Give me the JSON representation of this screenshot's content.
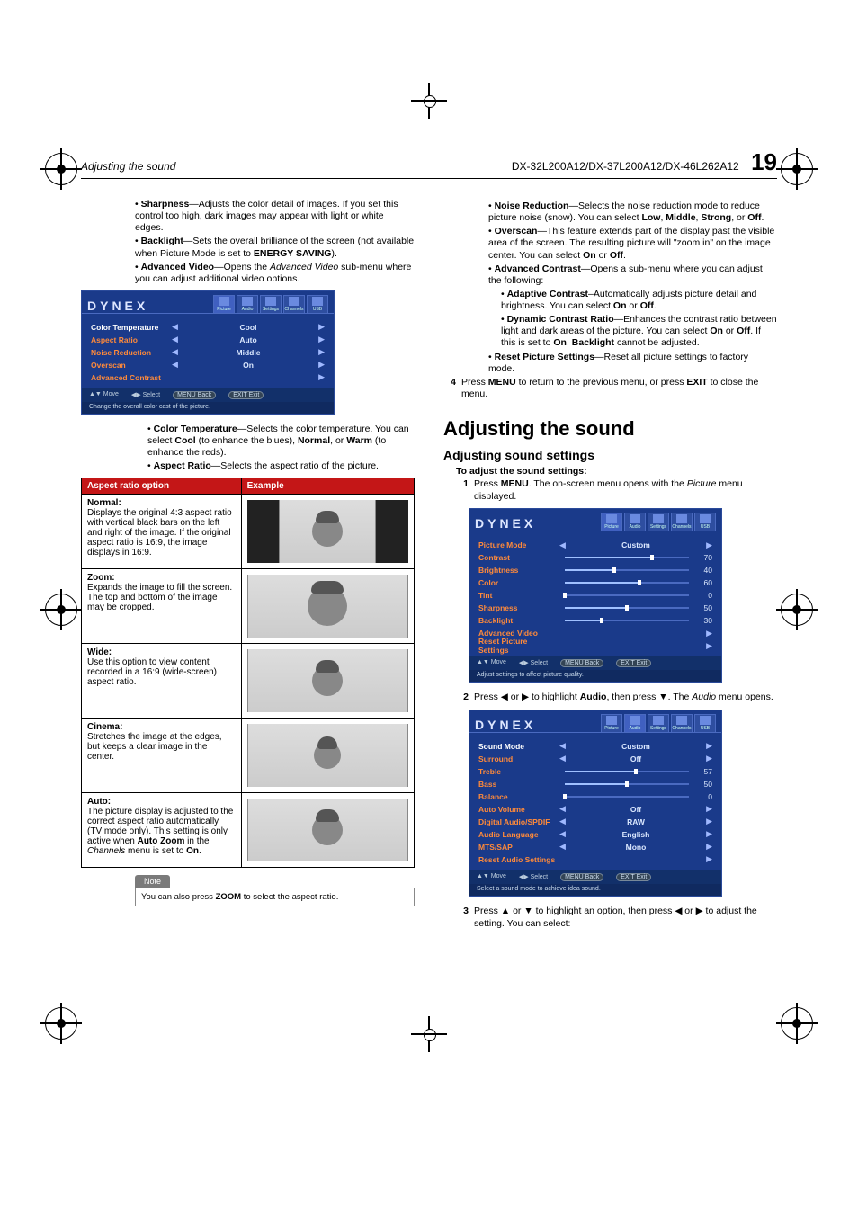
{
  "header": {
    "left": "Adjusting the sound",
    "models": "DX-32L200A12/DX-37L200A12/DX-46L262A12",
    "pageNum": "19"
  },
  "left": {
    "bullets1": [
      {
        "term": "Sharpness",
        "rest": "—Adjusts the color detail of images. If you set this control too high, dark images may appear with light or white edges."
      },
      {
        "term": "Backlight",
        "rest": "—Sets the overall brilliance of the screen (not available when Picture Mode is set to ",
        "term2": "ENERGY SAVING",
        "rest2": ")."
      },
      {
        "term": "Advanced Video",
        "rest": "—Opens the ",
        "ital": "Advanced Video",
        "rest2": " sub-menu where you can adjust additional video options."
      }
    ],
    "osd1": {
      "brand": "DYNEX",
      "tabs": [
        "Picture",
        "Audio",
        "Settings",
        "Channels",
        "USB"
      ],
      "activeTab": 0,
      "rows": [
        {
          "label": "Color Temperature",
          "labelColor": "white",
          "value": "Cool",
          "arrows": "both"
        },
        {
          "label": "Aspect Ratio",
          "value": "Auto",
          "arrows": "both"
        },
        {
          "label": "Noise Reduction",
          "value": "Middle",
          "arrows": "both"
        },
        {
          "label": "Overscan",
          "value": "On",
          "arrows": "both"
        },
        {
          "label": "Advanced Contrast",
          "value": "",
          "arrows": "right"
        }
      ],
      "hint": [
        "▲▼ Move",
        "◀▶ Select",
        "MENU Back",
        "EXIT Exit"
      ],
      "desc": "Change the overall color cast of the picture."
    },
    "bullets2": [
      {
        "html": "<b>Color Temperature</b>—Selects the color temperature. You can select <b>Cool</b> (to enhance the blues), <b>Normal</b>, or <b>Warm</b> (to enhance the reds)."
      },
      {
        "html": "<b>Aspect Ratio</b>—Selects the aspect ratio of the picture."
      }
    ],
    "aspect": {
      "h1": "Aspect ratio option",
      "h2": "Example",
      "rows": [
        {
          "title": "Normal:",
          "text": "Displays the original 4:3 aspect ratio with vertical black bars on the left and right of the image. If the original aspect ratio is 16:9, the image displays in 16:9.",
          "cls": "normal"
        },
        {
          "title": "Zoom:",
          "text": "Expands the image to fill the screen. The top and bottom of the image may be cropped.",
          "cls": "zoom"
        },
        {
          "title": "Wide:",
          "text": "Use this option to view content recorded in a 16:9 (wide-screen) aspect ratio.",
          "cls": "wide"
        },
        {
          "title": "Cinema:",
          "text": "Stretches the image at the edges, but keeps a clear image in the center.",
          "cls": "cinema"
        },
        {
          "title": "Auto:",
          "text": "The picture display is adjusted to the correct aspect ratio automatically (TV mode only). This setting is only active when <b>Auto Zoom</b> in the <i>Channels</i> menu is set to <b>On</b>.",
          "cls": "auto"
        }
      ]
    },
    "note": {
      "tab": "Note",
      "body": "You can also press <b>ZOOM</b> to select the aspect ratio."
    }
  },
  "right": {
    "bullets": [
      {
        "html": "<b>Noise Reduction</b>—Selects the noise reduction mode to reduce picture noise (snow). You can select <b>Low</b>, <b>Middle</b>, <b>Strong</b>, or <b>Off</b>."
      },
      {
        "html": "<b>Overscan</b>—This feature extends part of the display past the visible area of the screen. The resulting picture will \"zoom in\" on the image center. You can select <b>On</b> or <b>Off</b>."
      },
      {
        "html": "<b>Advanced Contrast</b>—Opens a sub-menu where you can adjust the following:",
        "sub": [
          {
            "html": "<b>Adaptive Contrast</b>–Automatically adjusts picture detail and brightness. You can select <b>On</b> or <b>Off</b>."
          },
          {
            "html": "<b>Dynamic Contrast Ratio</b>—Enhances the contrast ratio between light and dark areas of the picture. You can select <b>On</b> or <b>Off</b>. If this is set to <b>On</b>, <b>Backlight</b> cannot be adjusted."
          }
        ]
      },
      {
        "html": "<b>Reset Picture Settings</b>—Reset all picture settings to factory mode."
      }
    ],
    "step4": {
      "n": "4",
      "html": "Press <b>MENU</b> to return to the previous menu, or press <b>EXIT</b> to close the menu."
    },
    "h1": "Adjusting the sound",
    "h2": "Adjusting sound settings",
    "subhead": "To adjust the sound settings:",
    "step1": {
      "n": "1",
      "html": "Press <b>MENU</b>. The on-screen menu opens with the <i>Picture</i> menu displayed."
    },
    "osd2": {
      "brand": "DYNEX",
      "tabs": [
        "Picture",
        "Audio",
        "Settings",
        "Channels",
        "USB"
      ],
      "activeTab": 0,
      "rows": [
        {
          "label": "Picture Mode",
          "value": "Custom",
          "arrows": "both"
        },
        {
          "label": "Contrast",
          "slider": 70
        },
        {
          "label": "Brightness",
          "slider": 40
        },
        {
          "label": "Color",
          "slider": 60
        },
        {
          "label": "Tint",
          "slider": 0
        },
        {
          "label": "Sharpness",
          "slider": 50
        },
        {
          "label": "Backlight",
          "slider": 30
        },
        {
          "label": "Advanced Video",
          "value": "",
          "arrows": "right"
        },
        {
          "label": "Reset Picture Settings",
          "value": "",
          "arrows": "right"
        }
      ],
      "hint": [
        "▲▼ Move",
        "◀▶ Select",
        "MENU Back",
        "EXIT Exit"
      ],
      "desc": "Adjust settings to affect picture quality."
    },
    "step2": {
      "n": "2",
      "html": "Press ◀ or ▶ to highlight <b>Audio</b>, then press ▼. The <i>Audio</i> menu opens."
    },
    "osd3": {
      "brand": "DYNEX",
      "tabs": [
        "Picture",
        "Audio",
        "Settings",
        "Channels",
        "USB"
      ],
      "activeTab": 1,
      "rows": [
        {
          "label": "Sound Mode",
          "labelColor": "white",
          "value": "Custom",
          "arrows": "both"
        },
        {
          "label": "Surround",
          "value": "Off",
          "arrows": "both"
        },
        {
          "label": "Treble",
          "slider": 57
        },
        {
          "label": "Bass",
          "slider": 50
        },
        {
          "label": "Balance",
          "slider": 0
        },
        {
          "label": "Auto Volume",
          "value": "Off",
          "arrows": "both"
        },
        {
          "label": "Digital Audio/SPDIF",
          "value": "RAW",
          "arrows": "both"
        },
        {
          "label": "Audio Language",
          "value": "English",
          "arrows": "both"
        },
        {
          "label": "MTS/SAP",
          "value": "Mono",
          "arrows": "both"
        },
        {
          "label": "Reset Audio Settings",
          "value": "",
          "arrows": "right"
        }
      ],
      "hint": [
        "▲▼ Move",
        "◀▶ Select",
        "MENU Back",
        "EXIT Exit"
      ],
      "desc": "Select a sound mode to achieve idea sound."
    },
    "step3": {
      "n": "3",
      "html": "Press ▲ or ▼ to highlight an option, then press ◀ or ▶ to adjust the setting. You can select:"
    }
  }
}
